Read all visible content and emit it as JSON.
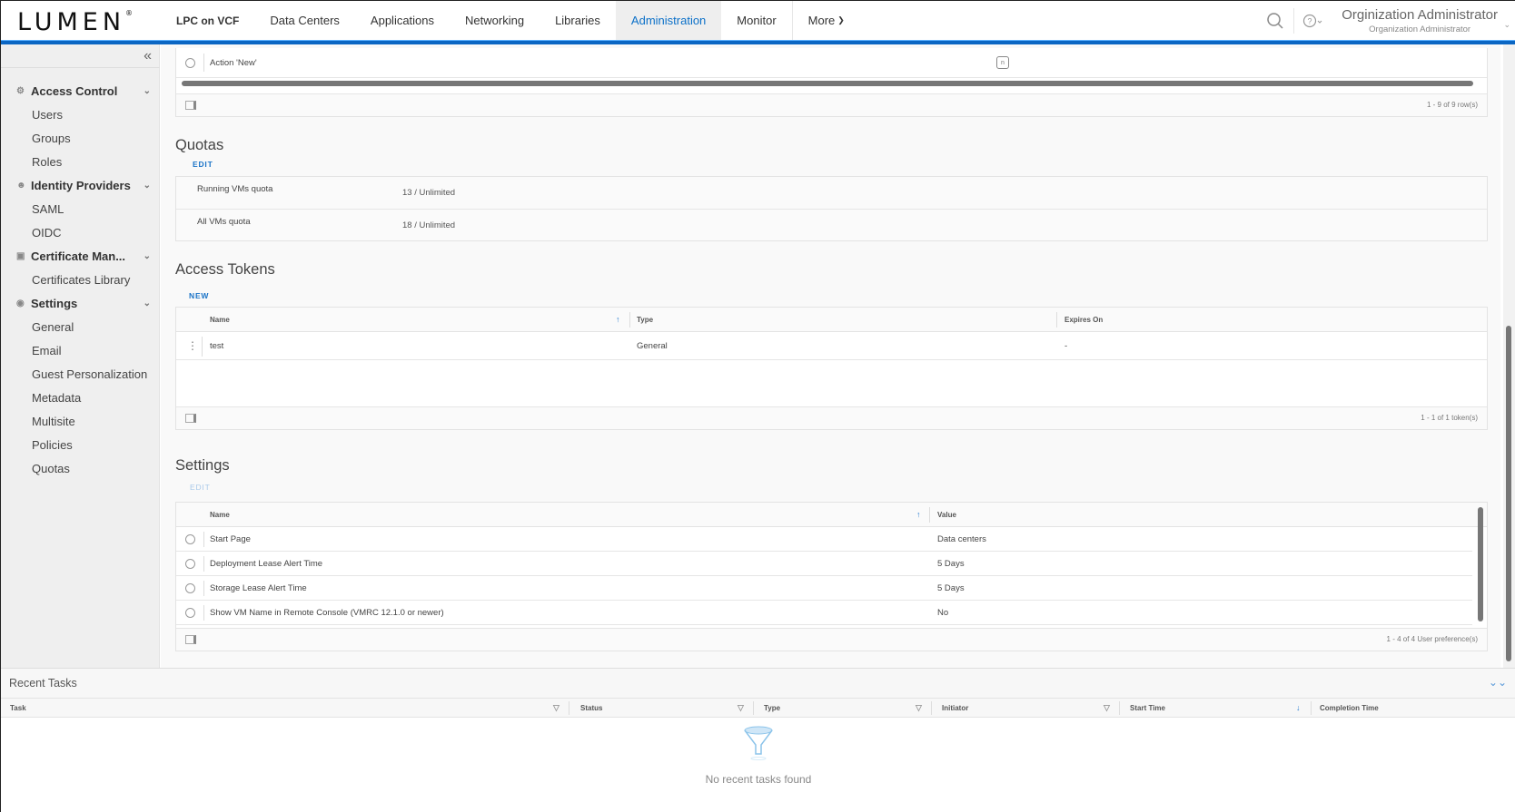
{
  "header": {
    "logo": "LUMEN",
    "brand": "LPC on VCF",
    "nav": [
      "Data Centers",
      "Applications",
      "Networking",
      "Libraries",
      "Administration",
      "Monitor"
    ],
    "active_nav": "Administration",
    "more_label": "More",
    "user_name": "Orginization Administrator",
    "user_role": "Organization Administrator",
    "accent_color": "#0b66c3"
  },
  "sidebar": {
    "groups": [
      {
        "label": "Access Control",
        "icon": "users-icon",
        "items": [
          "Users",
          "Groups",
          "Roles"
        ]
      },
      {
        "label": "Identity Providers",
        "icon": "identity-icon",
        "items": [
          "SAML",
          "OIDC"
        ]
      },
      {
        "label": "Certificate Man...",
        "icon": "certificate-icon",
        "items": [
          "Certificates Library"
        ]
      },
      {
        "label": "Settings",
        "icon": "gear-icon",
        "items": [
          "General",
          "Email",
          "Guest Personalization",
          "Metadata",
          "Multisite",
          "Policies",
          "Quotas"
        ]
      }
    ]
  },
  "rights_grid": {
    "row_label": "Action 'New'",
    "footer": "1 - 9 of 9 row(s)"
  },
  "quotas": {
    "title": "Quotas",
    "edit_label": "EDIT",
    "rows": [
      {
        "name": "Running VMs quota",
        "value": "13 / Unlimited"
      },
      {
        "name": "All VMs quota",
        "value": "18 / Unlimited"
      }
    ]
  },
  "tokens": {
    "title": "Access Tokens",
    "new_label": "NEW",
    "columns": [
      "Name",
      "Type",
      "Expires On"
    ],
    "rows": [
      {
        "name": "test",
        "type": "General",
        "expires": "-"
      }
    ],
    "footer": "1 - 1 of 1 token(s)"
  },
  "settings": {
    "title": "Settings",
    "edit_label": "EDIT",
    "columns": [
      "Name",
      "Value"
    ],
    "rows": [
      {
        "name": "Start Page",
        "value": "Data centers"
      },
      {
        "name": "Deployment Lease Alert Time",
        "value": "5 Days"
      },
      {
        "name": "Storage Lease Alert Time",
        "value": "5 Days"
      },
      {
        "name": "Show VM Name in Remote Console (VMRC 12.1.0 or newer)",
        "value": "No"
      }
    ],
    "footer": "1 - 4 of 4 User preference(s)"
  },
  "recent_tasks": {
    "title": "Recent Tasks",
    "columns": [
      "Task",
      "Status",
      "Type",
      "Initiator",
      "Start Time",
      "Completion Time"
    ],
    "empty_text": "No recent tasks found"
  }
}
